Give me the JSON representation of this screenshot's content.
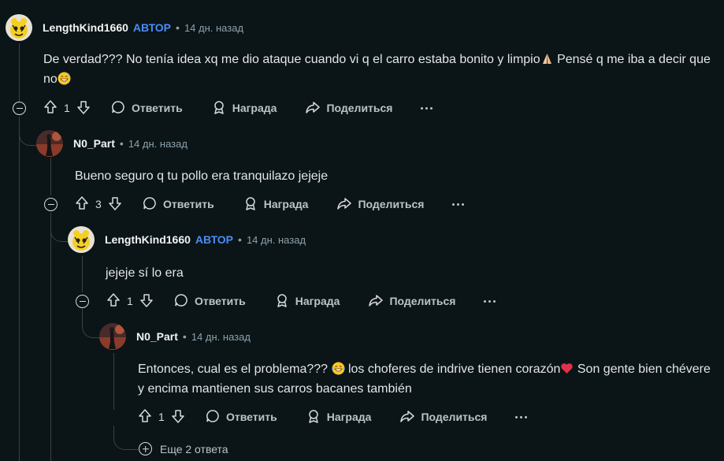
{
  "labels": {
    "op_badge": "АВТОР",
    "reply": "Ответить",
    "award": "Награда",
    "share": "Поделиться",
    "more_replies": "Еще 2 ответа"
  },
  "comments": [
    {
      "author": "LengthKind1660",
      "is_op": true,
      "time": "14 дн. назад",
      "text_a": "De verdad??? No tenía idea xq me dio ataque cuando vi q el carro estaba bonito y limpio",
      "text_b": " Pensé q me iba a decir que no",
      "score": "1",
      "emoji_a": "folded-hands",
      "emoji_b": "grinning-sweat"
    },
    {
      "author": "N0_Part",
      "is_op": false,
      "time": "14 дн. назад",
      "text": "Bueno seguro q tu pollo era tranquilazo jejeje",
      "score": "3"
    },
    {
      "author": "LengthKind1660",
      "is_op": true,
      "time": "14 дн. назад",
      "text": "jejeje sí lo era",
      "score": "1"
    },
    {
      "author": "N0_Part",
      "is_op": false,
      "time": "14 дн. назад",
      "text_a": "Entonces, cual es el problema???",
      "text_b": " los choferes de indrive tienen corazón",
      "text_c": " Son gente bien chévere y encima mantienen sus carros bacanes también",
      "score": "1",
      "emoji_a": "laughing-tears",
      "emoji_b": "red-heart"
    }
  ],
  "colors": {
    "background": "#0b1416",
    "op_badge": "#4b8cf7",
    "thread_line": "#3b4246"
  }
}
